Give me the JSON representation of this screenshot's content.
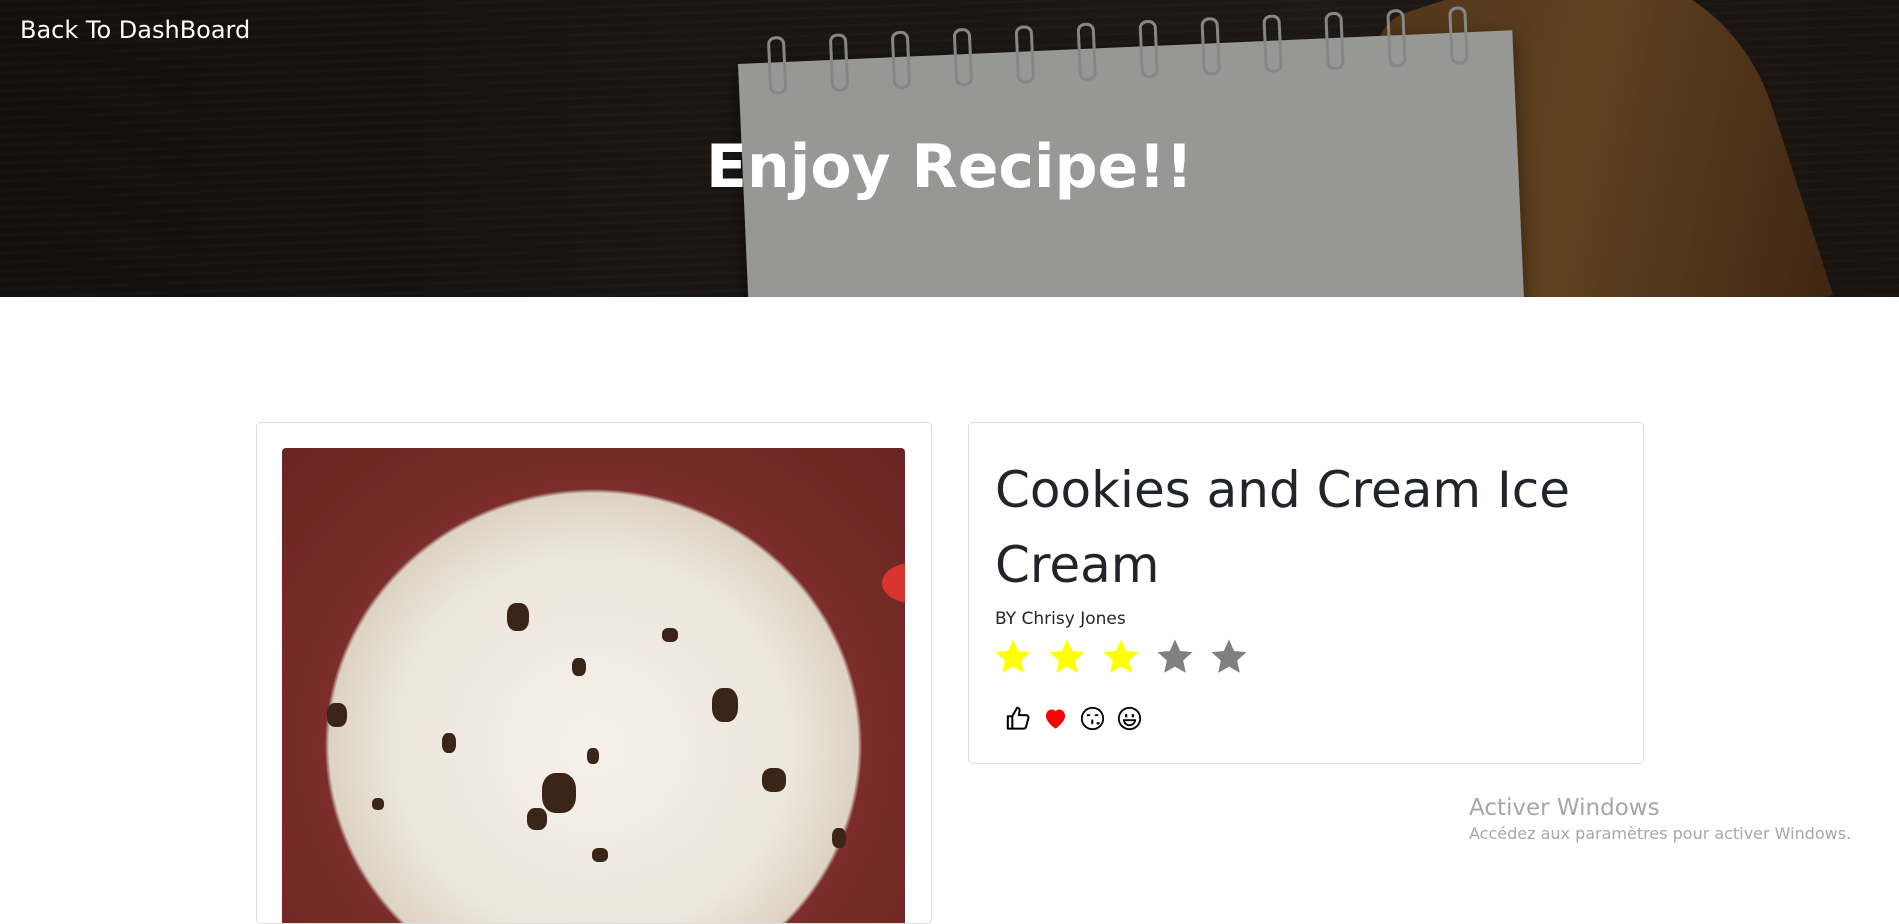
{
  "header": {
    "back_label": "Back To DashBoard",
    "title": "Enjoy Recipe!!"
  },
  "recipe": {
    "title": "Cookies and Cream Ice Cream",
    "author": "BY Chrisy Jones",
    "rating": 3,
    "max_rating": 5,
    "image_icon": "ice-cream-photo"
  },
  "reactions": [
    {
      "name": "like-icon",
      "color": "#000000"
    },
    {
      "name": "heart-icon",
      "color": "#ff0000"
    },
    {
      "name": "kiss-icon",
      "color": "#000000"
    },
    {
      "name": "smile-icon",
      "color": "#000000"
    }
  ],
  "colors": {
    "star_filled": "#ffff00",
    "star_empty": "#808080"
  },
  "watermark": {
    "title": "Activer Windows",
    "subtitle": "Accédez aux paramètres pour activer Windows."
  }
}
